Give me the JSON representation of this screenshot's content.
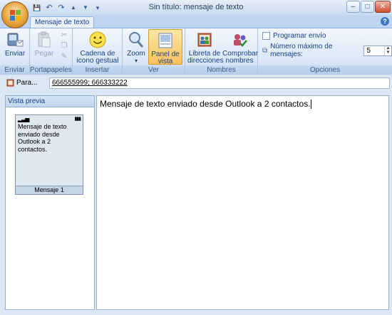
{
  "window": {
    "title": "Sin título: mensaje de texto",
    "buttons": {
      "minimize": "–",
      "maximize": "□",
      "close": "✕"
    }
  },
  "qat": {
    "save": "💾",
    "undo": "↶",
    "redo": "↷",
    "up": "▲",
    "down": "▼",
    "more": "▾"
  },
  "tabs": [
    {
      "label": "Mensaje de texto",
      "active": true
    }
  ],
  "help_label": "?",
  "ribbon": {
    "groups": {
      "enviar": {
        "label": "Enviar",
        "send_label": "Enviar"
      },
      "portapapeles": {
        "label": "Portapapeles",
        "paste_label": "Pegar"
      },
      "insertar": {
        "label": "Insertar",
        "emoticon_label_1": "Cadena de",
        "emoticon_label_2": "icono gestual ▾"
      },
      "ver": {
        "label": "Ver",
        "zoom_label": "Zoom",
        "zoom_arrow": "▾",
        "preview_label_1": "Panel de",
        "preview_label_2": "vista previa"
      },
      "nombres": {
        "label": "Nombres",
        "address_label_1": "Libreta de",
        "address_label_2": "direcciones",
        "check_label_1": "Comprobar",
        "check_label_2": "nombres"
      },
      "opciones": {
        "label": "Opciones",
        "schedule_label": "Programar envío",
        "max_messages_label": "Número máximo de mensajes:",
        "max_messages_value": "5"
      }
    }
  },
  "to": {
    "button_label": "Para...",
    "recipients": "666555999; 666333222"
  },
  "preview": {
    "header": "Vista previa",
    "signal": "▂▃▅",
    "battery": "▮▮▮",
    "message_text": "Mensaje de texto enviado desde Outlook a 2 contactos.",
    "footer": "Mensaje 1"
  },
  "editor": {
    "text": "Mensaje de texto enviado desde Outlook a 2 contactos."
  },
  "colors": {
    "accent": "#15428b",
    "active_button": "#f9c25c",
    "ribbon_bg": "#dbe7f6"
  }
}
